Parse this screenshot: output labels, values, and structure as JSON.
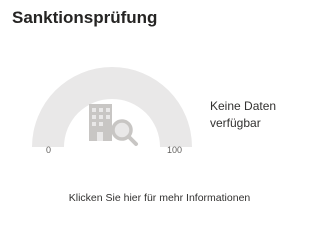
{
  "card": {
    "title": "Sanktionsprüfung",
    "no_data_text": "Keine Daten verfügbar",
    "more_info_link": "Klicken Sie hier für mehr Informationen"
  },
  "gauge": {
    "min_label": "0",
    "max_label": "100",
    "value": null,
    "track_color": "#e9e8e8",
    "icon_color": "#c8c6c4",
    "icon": "building-search-icon"
  }
}
